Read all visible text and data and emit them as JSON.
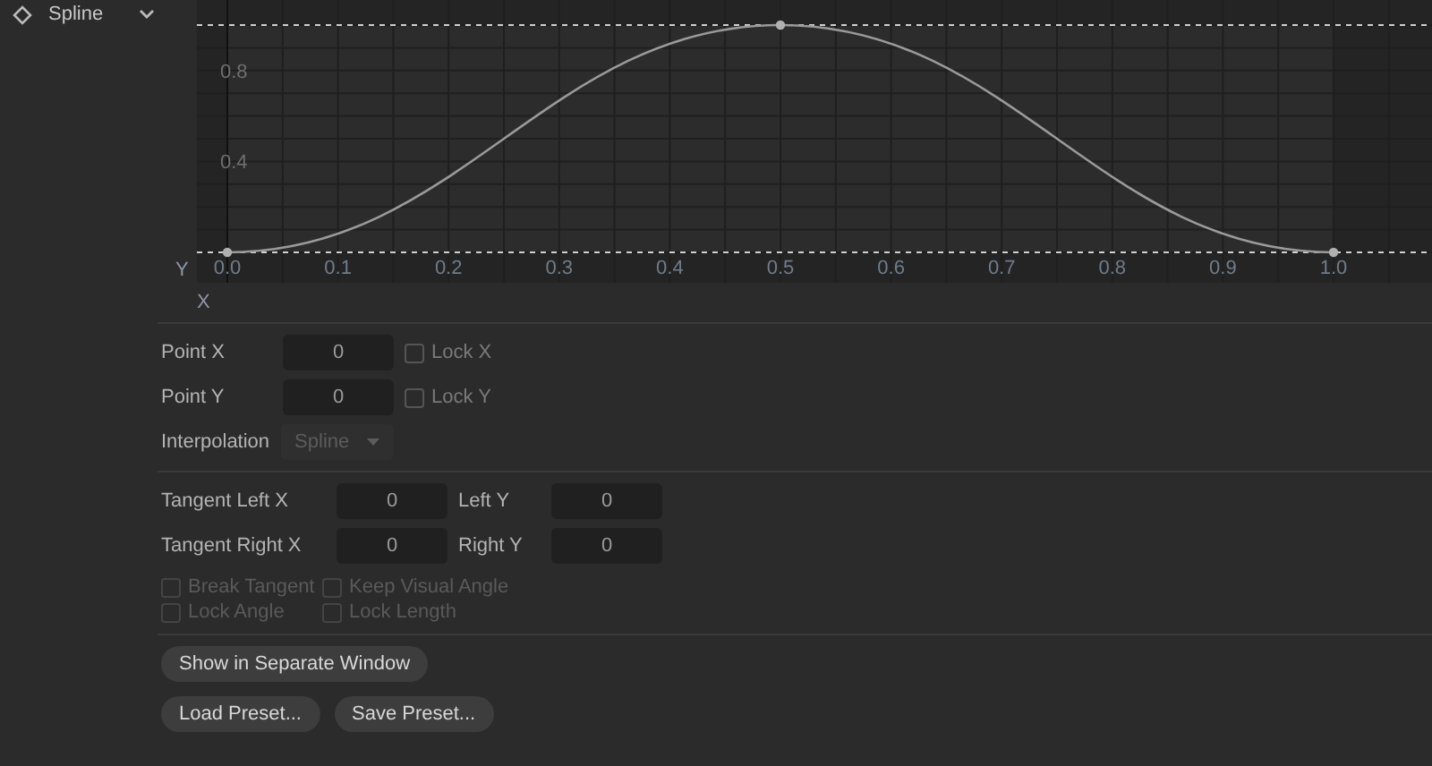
{
  "header": {
    "title": "Spline",
    "expanded": true
  },
  "curve_editor": {
    "y_axis_label": "Y",
    "x_axis_label": "X",
    "chart_data": {
      "type": "line",
      "x": [
        0,
        0.5,
        1
      ],
      "series": [
        {
          "color": "#9a9a9a",
          "marker": true,
          "values": [
            0,
            1,
            0
          ]
        }
      ],
      "grid": true,
      "xlim": [
        0,
        1
      ],
      "ylim": [
        0,
        1
      ],
      "xticks": [
        {
          "value": 0,
          "label": "0.0"
        },
        {
          "value": 0.1,
          "label": "0.1"
        },
        {
          "value": 0.2,
          "label": "0.2"
        },
        {
          "value": 0.3,
          "label": "0.3"
        },
        {
          "value": 0.4,
          "label": "0.4"
        },
        {
          "value": 0.5,
          "label": "0.5"
        },
        {
          "value": 0.6,
          "label": "0.6"
        },
        {
          "value": 0.7,
          "label": "0.7"
        },
        {
          "value": 0.8,
          "label": "0.8"
        },
        {
          "value": 0.9,
          "label": "0.9"
        },
        {
          "value": 1,
          "label": "1.0"
        }
      ],
      "yticks": [
        {
          "value": 0.4,
          "label": "0.4"
        },
        {
          "value": 0.8,
          "label": "0.8"
        }
      ]
    }
  },
  "point_fields": [
    {
      "label": "Point X",
      "value": "0",
      "lock": {
        "label": "Lock X",
        "checked": false
      }
    },
    {
      "label": "Point Y",
      "value": "0",
      "lock": {
        "label": "Lock Y",
        "checked": false
      }
    }
  ],
  "interpolation": {
    "label": "Interpolation",
    "value": "Spline",
    "disabled": true
  },
  "tangent_fields": [
    {
      "label": "Tangent Left X",
      "value": "0",
      "label_2": "Left Y",
      "value_2": "0"
    },
    {
      "label": "Tangent Right X",
      "value": "0",
      "label_2": "Right Y",
      "value_2": "0"
    }
  ],
  "tangent_options": [
    {
      "label": "Break Tangent",
      "checked": false,
      "disabled": true
    },
    {
      "label": "Keep Visual Angle",
      "checked": false,
      "disabled": true
    },
    {
      "label": "Lock Angle",
      "checked": false,
      "disabled": true
    },
    {
      "label": "Lock Length",
      "checked": false,
      "disabled": true
    }
  ],
  "buttons": [
    [
      {
        "label": "Show in Separate Window"
      }
    ],
    [
      {
        "label": "Load Preset..."
      },
      {
        "label": "Save Preset..."
      }
    ]
  ]
}
